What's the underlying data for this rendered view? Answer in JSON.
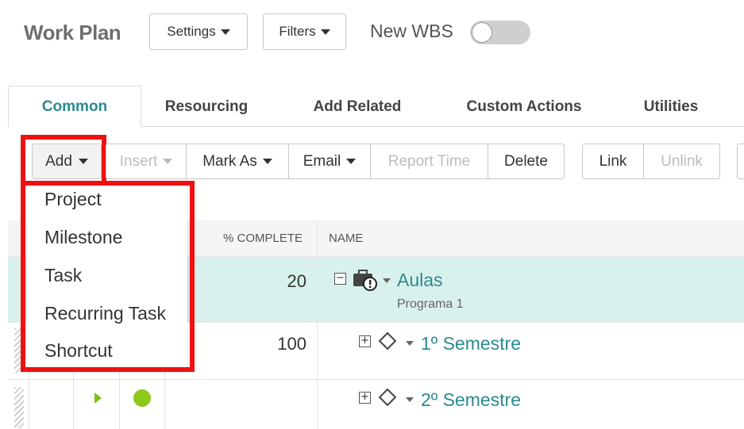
{
  "header": {
    "title": "Work Plan",
    "settings_label": "Settings",
    "filters_label": "Filters",
    "new_wbs_label": "New WBS",
    "new_wbs_on": false
  },
  "tabs": [
    {
      "label": "Common",
      "active": true
    },
    {
      "label": "Resourcing",
      "active": false
    },
    {
      "label": "Add Related",
      "active": false
    },
    {
      "label": "Custom Actions",
      "active": false
    },
    {
      "label": "Utilities",
      "active": false
    }
  ],
  "toolbar": {
    "add": "Add",
    "insert": "Insert",
    "mark_as": "Mark As",
    "email": "Email",
    "report_time": "Report Time",
    "delete": "Delete",
    "link": "Link",
    "unlink": "Unlink"
  },
  "add_menu": {
    "items": [
      "Project",
      "Milestone",
      "Task",
      "Recurring Task",
      "Shortcut"
    ]
  },
  "grid": {
    "columns": {
      "percent_complete": "% COMPLETE",
      "name": "NAME"
    },
    "rows": [
      {
        "percent": "20",
        "name": "Aulas",
        "subtitle": "Programa 1",
        "selected": true
      },
      {
        "percent": "100",
        "name": "1º Semestre"
      },
      {
        "percent": "",
        "name": "2º Semestre"
      }
    ]
  },
  "colors": {
    "accent": "#2a8a8e",
    "highlight": "#ee1111",
    "selected_row": "#d9f1ec",
    "status_green": "#8cc91a"
  }
}
